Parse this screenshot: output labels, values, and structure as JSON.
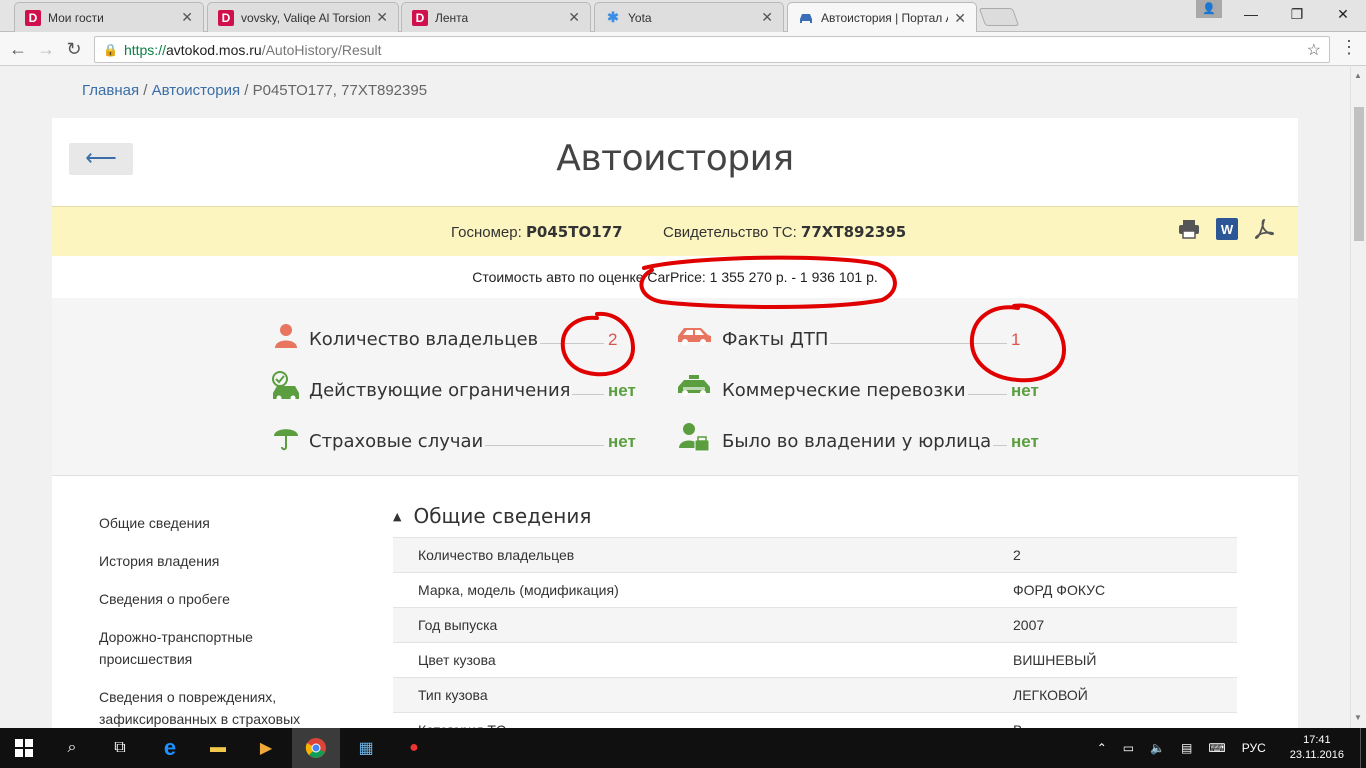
{
  "browser": {
    "tabs": [
      {
        "icon": "d-favicon",
        "glyph": "D",
        "label": "Мои гости"
      },
      {
        "icon": "d-favicon",
        "glyph": "D",
        "label": "vovsky, Valiqe Al Torsion"
      },
      {
        "icon": "d-favicon",
        "glyph": "D",
        "label": "Лента"
      },
      {
        "icon": "yota-favicon",
        "glyph": "✱",
        "label": "Yota"
      },
      {
        "icon": "car-favicon",
        "glyph": "🚗",
        "label": "Автоистория | Портал А"
      }
    ],
    "url_scheme": "https://",
    "url_host": "avtokod.mos.ru",
    "url_path": "/AutoHistory/Result"
  },
  "breadcrumb": {
    "home": "Главная",
    "sep1": " / ",
    "section": "Автоистория",
    "sep2": " / ",
    "current": "Р045ТО177, 77ХТ892395"
  },
  "page": {
    "title": "Автоистория",
    "back_glyph": "⟵"
  },
  "vehicle": {
    "plate_label": "Госномер:",
    "plate": "Р045ТО177",
    "cert_label": "Свидетельство ТС:",
    "cert": "77ХТ892395",
    "price_text": "Стоимость авто по оценке CarPrice: 1 355 270 р. - 1 936 101 р."
  },
  "summary": [
    {
      "icon": "person-icon",
      "label": "Количество владельцев",
      "value": "2",
      "color": "#d9534f"
    },
    {
      "icon": "car-crash-icon",
      "label": "Факты ДТП",
      "value": "1",
      "color": "#d9534f"
    },
    {
      "icon": "car-check-icon",
      "label": "Действующие ограничения",
      "value": "нет",
      "color": "#5a9e3f"
    },
    {
      "icon": "taxi-icon",
      "label": "Коммерческие перевозки",
      "value": "нет",
      "color": "#5a9e3f"
    },
    {
      "icon": "umbrella-icon",
      "label": "Страховые случаи",
      "value": "нет",
      "color": "#5a9e3f"
    },
    {
      "icon": "company-owner-icon",
      "label": "Было во владении у юрлица",
      "value": "нет",
      "color": "#5a9e3f"
    }
  ],
  "sidenav": [
    "Общие сведения",
    "История владения",
    "Сведения о пробеге",
    "Дорожно-транспортные происшествия",
    "Сведения о повреждениях, зафиксированных в страховых"
  ],
  "general": {
    "heading": "Общие сведения",
    "rows": [
      {
        "key": "Количество владельцев",
        "value": "2"
      },
      {
        "key": "Марка, модель (модификация)",
        "value": "ФОРД ФОКУС"
      },
      {
        "key": "Год выпуска",
        "value": "2007"
      },
      {
        "key": "Цвет кузова",
        "value": "ВИШНЕВЫЙ"
      },
      {
        "key": "Тип кузова",
        "value": "ЛЕГКОВОЙ"
      },
      {
        "key": "Категория ТС",
        "value": "В"
      }
    ]
  },
  "taskbar": {
    "lang": "РУС",
    "time": "17:41",
    "date": "23.11.2016"
  }
}
